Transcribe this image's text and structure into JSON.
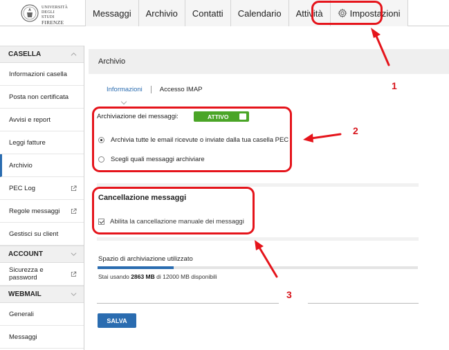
{
  "logo": {
    "line1": "UNIVERSITÀ",
    "line2": "DEGLI STUDI",
    "line3": "FIRENZE"
  },
  "nav": {
    "tabs": [
      {
        "label": "Messaggi"
      },
      {
        "label": "Archivio"
      },
      {
        "label": "Contatti"
      },
      {
        "label": "Calendario"
      },
      {
        "label": "Attività"
      },
      {
        "label": "Impostazioni"
      }
    ]
  },
  "sidebar": {
    "sections": [
      {
        "title": "CASELLA",
        "items": [
          {
            "label": "Informazioni casella"
          },
          {
            "label": "Posta non certificata"
          },
          {
            "label": "Avvisi e report"
          },
          {
            "label": "Leggi fatture"
          },
          {
            "label": "Archivio"
          },
          {
            "label": "PEC Log"
          },
          {
            "label": "Regole messaggi"
          },
          {
            "label": "Gestisci su client"
          }
        ]
      },
      {
        "title": "ACCOUNT",
        "items": [
          {
            "label": "Sicurezza e password"
          }
        ]
      },
      {
        "title": "WEBMAIL",
        "items": [
          {
            "label": "Generali"
          },
          {
            "label": "Messaggi"
          }
        ]
      }
    ]
  },
  "main": {
    "panel_title": "Archivio",
    "tabs": [
      {
        "label": "Informazioni"
      },
      {
        "label": "Accesso IMAP"
      }
    ],
    "archiving": {
      "label": "Archiviazione dei messaggi:",
      "toggle_label": "ATTIVO",
      "options": [
        {
          "label": "Archivia tutte le email ricevute o inviate dalla tua casella PEC",
          "selected": true
        },
        {
          "label": "Scegli quali messaggi archiviare",
          "selected": false
        }
      ]
    },
    "deletion": {
      "title": "Cancellazione messaggi",
      "checkbox_label": "Abilita la cancellazione manuale dei messaggi",
      "checked": true
    },
    "storage": {
      "label": "Spazio di archiviazione utilizzato",
      "text_prefix": "Stai usando",
      "used": "2863 MB",
      "text_middle": "di",
      "total": "12000 MB",
      "text_suffix": "disponibili",
      "used_fraction": 0.2386
    },
    "save_label": "SALVA"
  },
  "annotations": {
    "numbers": [
      "1",
      "2",
      "3"
    ],
    "color": "#e5141b"
  },
  "colors": {
    "accent": "#2a6cb0",
    "toggle_on": "#4aa527"
  }
}
